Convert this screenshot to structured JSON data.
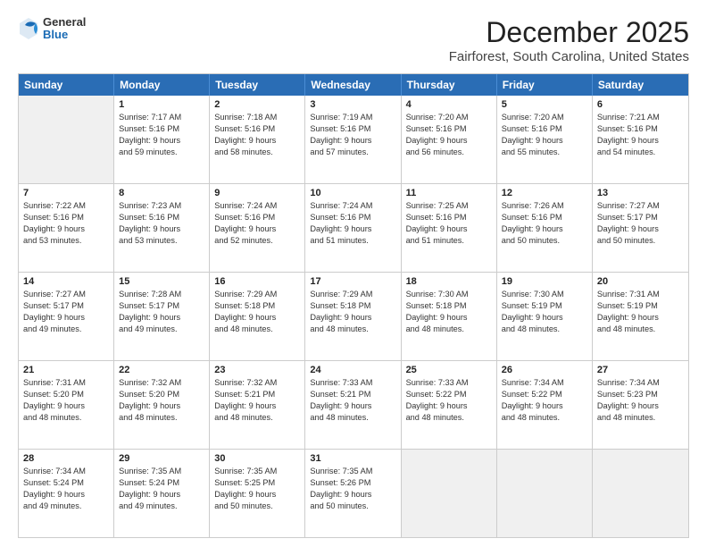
{
  "header": {
    "logo_general": "General",
    "logo_blue": "Blue",
    "title": "December 2025",
    "subtitle": "Fairforest, South Carolina, United States"
  },
  "days_of_week": [
    "Sunday",
    "Monday",
    "Tuesday",
    "Wednesday",
    "Thursday",
    "Friday",
    "Saturday"
  ],
  "weeks": [
    [
      {
        "day": "",
        "empty": true
      },
      {
        "day": "1",
        "sunrise": "Sunrise: 7:17 AM",
        "sunset": "Sunset: 5:16 PM",
        "daylight": "Daylight: 9 hours",
        "daylight2": "and 59 minutes."
      },
      {
        "day": "2",
        "sunrise": "Sunrise: 7:18 AM",
        "sunset": "Sunset: 5:16 PM",
        "daylight": "Daylight: 9 hours",
        "daylight2": "and 58 minutes."
      },
      {
        "day": "3",
        "sunrise": "Sunrise: 7:19 AM",
        "sunset": "Sunset: 5:16 PM",
        "daylight": "Daylight: 9 hours",
        "daylight2": "and 57 minutes."
      },
      {
        "day": "4",
        "sunrise": "Sunrise: 7:20 AM",
        "sunset": "Sunset: 5:16 PM",
        "daylight": "Daylight: 9 hours",
        "daylight2": "and 56 minutes."
      },
      {
        "day": "5",
        "sunrise": "Sunrise: 7:20 AM",
        "sunset": "Sunset: 5:16 PM",
        "daylight": "Daylight: 9 hours",
        "daylight2": "and 55 minutes."
      },
      {
        "day": "6",
        "sunrise": "Sunrise: 7:21 AM",
        "sunset": "Sunset: 5:16 PM",
        "daylight": "Daylight: 9 hours",
        "daylight2": "and 54 minutes."
      }
    ],
    [
      {
        "day": "7",
        "sunrise": "Sunrise: 7:22 AM",
        "sunset": "Sunset: 5:16 PM",
        "daylight": "Daylight: 9 hours",
        "daylight2": "and 53 minutes."
      },
      {
        "day": "8",
        "sunrise": "Sunrise: 7:23 AM",
        "sunset": "Sunset: 5:16 PM",
        "daylight": "Daylight: 9 hours",
        "daylight2": "and 53 minutes."
      },
      {
        "day": "9",
        "sunrise": "Sunrise: 7:24 AM",
        "sunset": "Sunset: 5:16 PM",
        "daylight": "Daylight: 9 hours",
        "daylight2": "and 52 minutes."
      },
      {
        "day": "10",
        "sunrise": "Sunrise: 7:24 AM",
        "sunset": "Sunset: 5:16 PM",
        "daylight": "Daylight: 9 hours",
        "daylight2": "and 51 minutes."
      },
      {
        "day": "11",
        "sunrise": "Sunrise: 7:25 AM",
        "sunset": "Sunset: 5:16 PM",
        "daylight": "Daylight: 9 hours",
        "daylight2": "and 51 minutes."
      },
      {
        "day": "12",
        "sunrise": "Sunrise: 7:26 AM",
        "sunset": "Sunset: 5:16 PM",
        "daylight": "Daylight: 9 hours",
        "daylight2": "and 50 minutes."
      },
      {
        "day": "13",
        "sunrise": "Sunrise: 7:27 AM",
        "sunset": "Sunset: 5:17 PM",
        "daylight": "Daylight: 9 hours",
        "daylight2": "and 50 minutes."
      }
    ],
    [
      {
        "day": "14",
        "sunrise": "Sunrise: 7:27 AM",
        "sunset": "Sunset: 5:17 PM",
        "daylight": "Daylight: 9 hours",
        "daylight2": "and 49 minutes."
      },
      {
        "day": "15",
        "sunrise": "Sunrise: 7:28 AM",
        "sunset": "Sunset: 5:17 PM",
        "daylight": "Daylight: 9 hours",
        "daylight2": "and 49 minutes."
      },
      {
        "day": "16",
        "sunrise": "Sunrise: 7:29 AM",
        "sunset": "Sunset: 5:18 PM",
        "daylight": "Daylight: 9 hours",
        "daylight2": "and 48 minutes."
      },
      {
        "day": "17",
        "sunrise": "Sunrise: 7:29 AM",
        "sunset": "Sunset: 5:18 PM",
        "daylight": "Daylight: 9 hours",
        "daylight2": "and 48 minutes."
      },
      {
        "day": "18",
        "sunrise": "Sunrise: 7:30 AM",
        "sunset": "Sunset: 5:18 PM",
        "daylight": "Daylight: 9 hours",
        "daylight2": "and 48 minutes."
      },
      {
        "day": "19",
        "sunrise": "Sunrise: 7:30 AM",
        "sunset": "Sunset: 5:19 PM",
        "daylight": "Daylight: 9 hours",
        "daylight2": "and 48 minutes."
      },
      {
        "day": "20",
        "sunrise": "Sunrise: 7:31 AM",
        "sunset": "Sunset: 5:19 PM",
        "daylight": "Daylight: 9 hours",
        "daylight2": "and 48 minutes."
      }
    ],
    [
      {
        "day": "21",
        "sunrise": "Sunrise: 7:31 AM",
        "sunset": "Sunset: 5:20 PM",
        "daylight": "Daylight: 9 hours",
        "daylight2": "and 48 minutes."
      },
      {
        "day": "22",
        "sunrise": "Sunrise: 7:32 AM",
        "sunset": "Sunset: 5:20 PM",
        "daylight": "Daylight: 9 hours",
        "daylight2": "and 48 minutes."
      },
      {
        "day": "23",
        "sunrise": "Sunrise: 7:32 AM",
        "sunset": "Sunset: 5:21 PM",
        "daylight": "Daylight: 9 hours",
        "daylight2": "and 48 minutes."
      },
      {
        "day": "24",
        "sunrise": "Sunrise: 7:33 AM",
        "sunset": "Sunset: 5:21 PM",
        "daylight": "Daylight: 9 hours",
        "daylight2": "and 48 minutes."
      },
      {
        "day": "25",
        "sunrise": "Sunrise: 7:33 AM",
        "sunset": "Sunset: 5:22 PM",
        "daylight": "Daylight: 9 hours",
        "daylight2": "and 48 minutes."
      },
      {
        "day": "26",
        "sunrise": "Sunrise: 7:34 AM",
        "sunset": "Sunset: 5:22 PM",
        "daylight": "Daylight: 9 hours",
        "daylight2": "and 48 minutes."
      },
      {
        "day": "27",
        "sunrise": "Sunrise: 7:34 AM",
        "sunset": "Sunset: 5:23 PM",
        "daylight": "Daylight: 9 hours",
        "daylight2": "and 48 minutes."
      }
    ],
    [
      {
        "day": "28",
        "sunrise": "Sunrise: 7:34 AM",
        "sunset": "Sunset: 5:24 PM",
        "daylight": "Daylight: 9 hours",
        "daylight2": "and 49 minutes."
      },
      {
        "day": "29",
        "sunrise": "Sunrise: 7:35 AM",
        "sunset": "Sunset: 5:24 PM",
        "daylight": "Daylight: 9 hours",
        "daylight2": "and 49 minutes."
      },
      {
        "day": "30",
        "sunrise": "Sunrise: 7:35 AM",
        "sunset": "Sunset: 5:25 PM",
        "daylight": "Daylight: 9 hours",
        "daylight2": "and 50 minutes."
      },
      {
        "day": "31",
        "sunrise": "Sunrise: 7:35 AM",
        "sunset": "Sunset: 5:26 PM",
        "daylight": "Daylight: 9 hours",
        "daylight2": "and 50 minutes."
      },
      {
        "day": "",
        "empty": true
      },
      {
        "day": "",
        "empty": true
      },
      {
        "day": "",
        "empty": true
      }
    ]
  ]
}
